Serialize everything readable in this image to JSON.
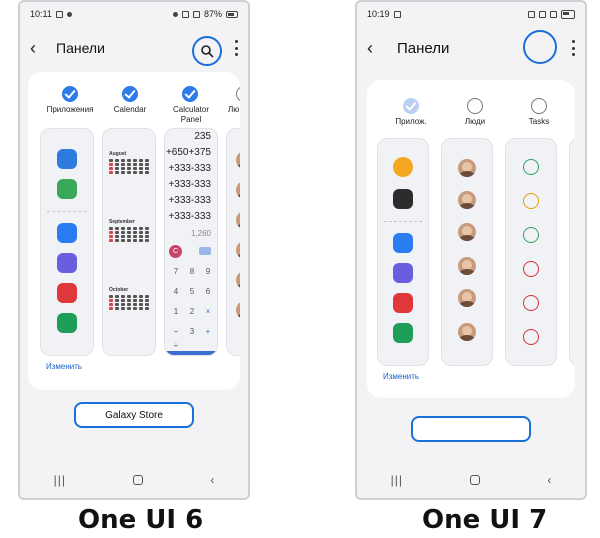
{
  "left": {
    "status": {
      "time": "10:11",
      "battery": "87%"
    },
    "appbar": {
      "title": "Панели"
    },
    "panels": [
      {
        "label": "Приложения",
        "checked": true
      },
      {
        "label": "Calendar",
        "checked": true
      },
      {
        "label": "Calculator Panel",
        "checked": true
      },
      {
        "label": "Лю",
        "checked": false
      }
    ],
    "calendar_months": [
      "August",
      "September",
      "October"
    ],
    "calculator_lines": [
      "235",
      "+650+375",
      "+333-333",
      "+333-333",
      "+333-333",
      "+333-333",
      "1,260"
    ],
    "calc_keys": [
      "7",
      "8",
      "9",
      "4",
      "5",
      "6",
      "1",
      "2",
      "3",
      "×",
      "−",
      "+"
    ],
    "calc_c": "C",
    "calc_div": "÷",
    "edit_label": "Изменить",
    "store_button": "Galaxy Store",
    "caption": "One UI 6",
    "colors": {
      "accent": "#1a6fd8",
      "check": "#2f7be8"
    }
  },
  "right": {
    "status": {
      "time": "10:19"
    },
    "appbar": {
      "title": "Панели"
    },
    "panels": [
      {
        "label": "Прилож.",
        "checked": true
      },
      {
        "label": "Люди",
        "checked": false
      },
      {
        "label": "Tasks",
        "checked": false
      }
    ],
    "edit_label": "Изменить",
    "caption": "One UI 7",
    "icons": {
      "apps": [
        "lightbulb-icon",
        "toggle-icon",
        "messages-icon",
        "internet-icon",
        "notes-icon",
        "phone-icon"
      ],
      "tasks": [
        "search-contact-icon",
        "alarm-icon",
        "add-event-icon",
        "voice-record-icon",
        "edit-icon",
        "add-contact-icon"
      ]
    }
  }
}
